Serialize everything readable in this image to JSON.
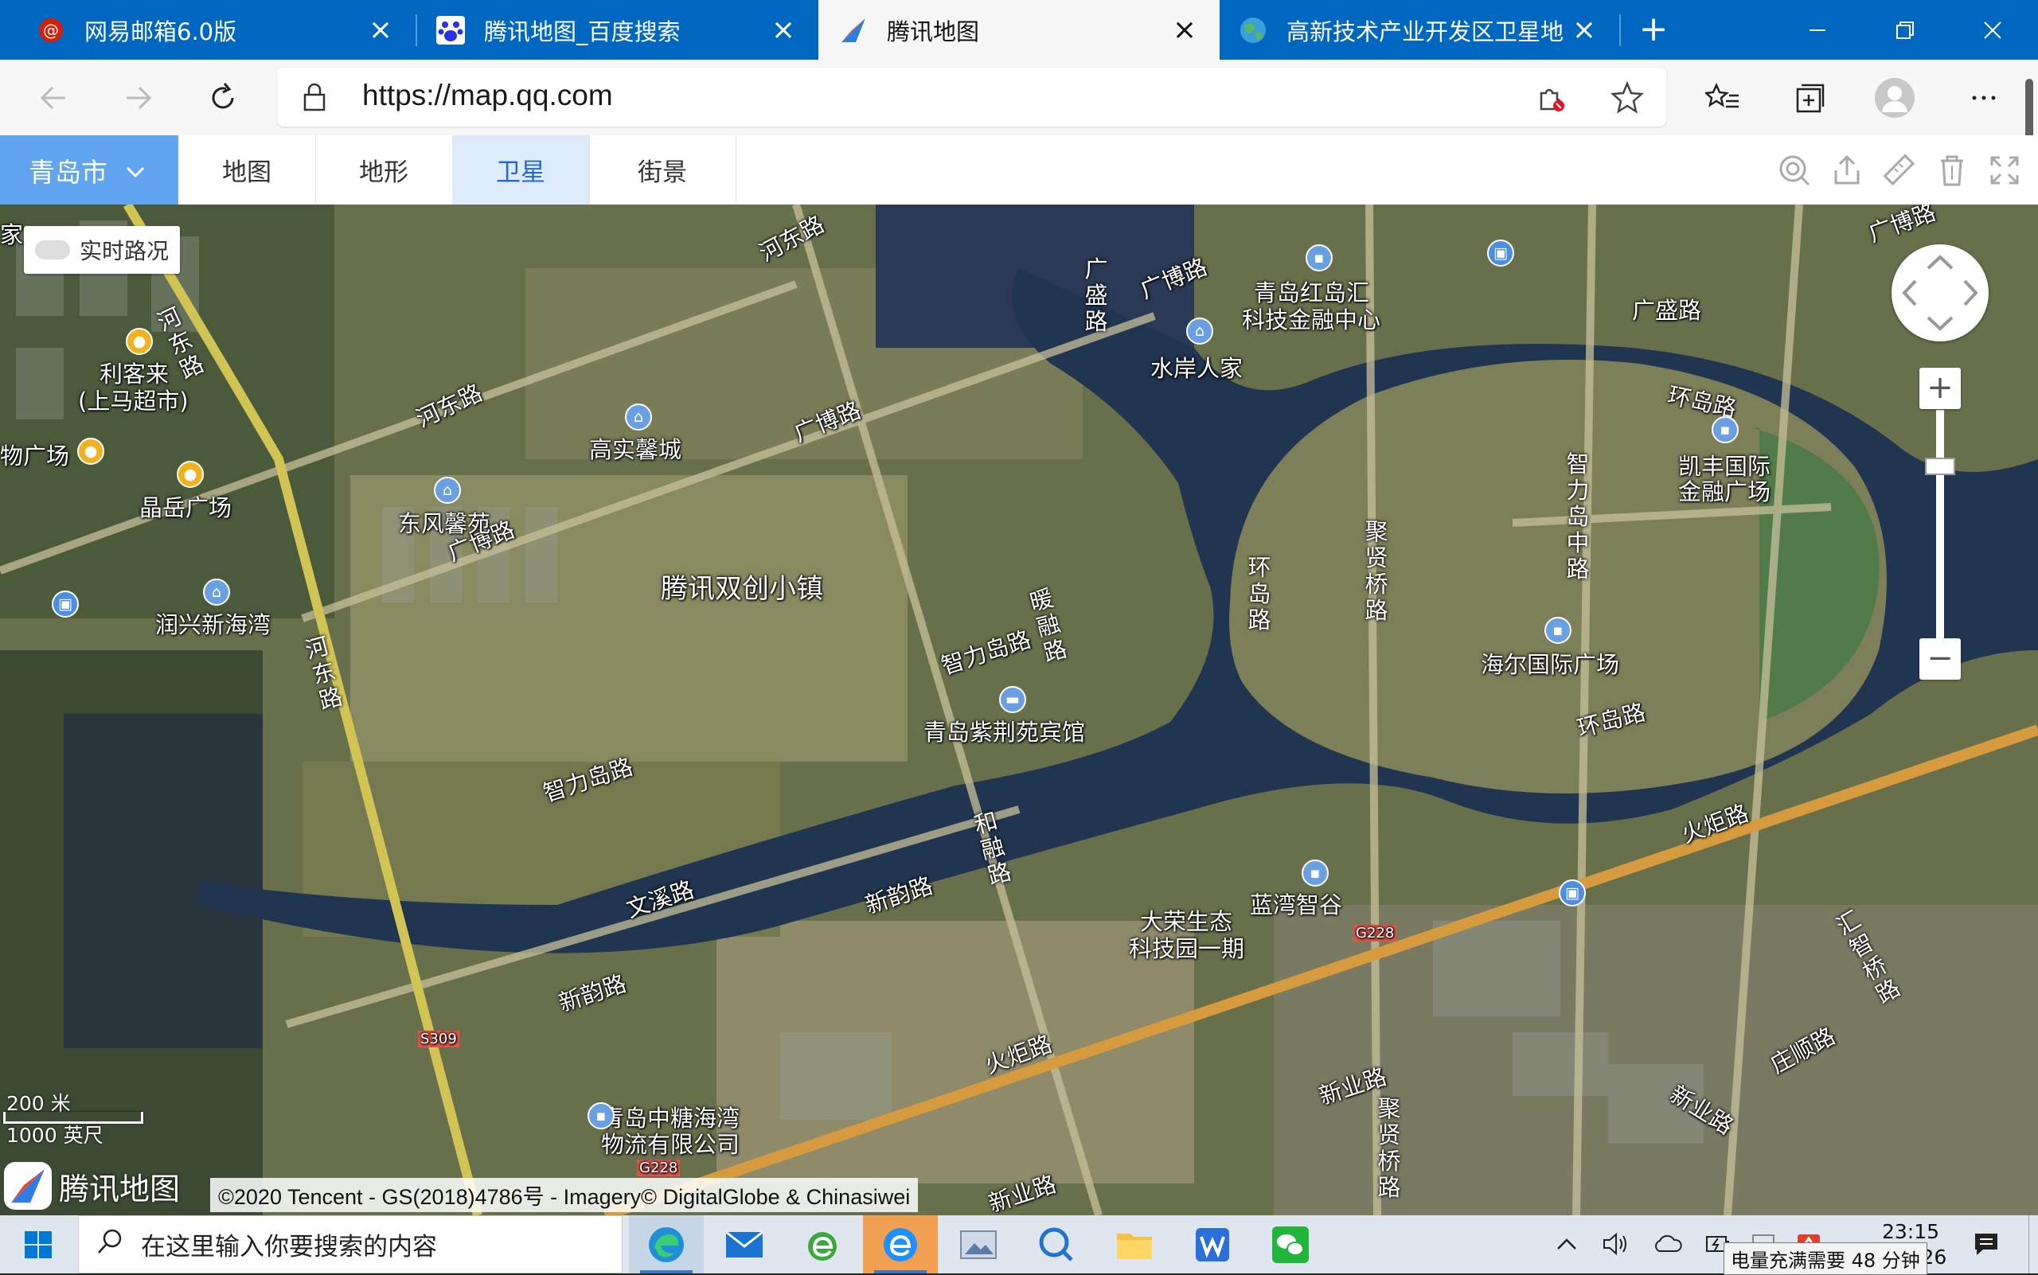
{
  "browser": {
    "tabs": [
      {
        "label": "网易邮箱6.0版",
        "icon": "netease-mail-icon",
        "active": false
      },
      {
        "label": "腾讯地图_百度搜索",
        "icon": "baidu-paw-icon",
        "active": false
      },
      {
        "label": "腾讯地图",
        "icon": "tencent-map-icon",
        "active": true
      },
      {
        "label": "高新技术产业开发区卫星地",
        "icon": "globe-icon",
        "active": false
      }
    ],
    "url": "https://map.qq.com"
  },
  "map_toolbar": {
    "city": "青岛市",
    "tabs": [
      "地图",
      "地形",
      "卫星",
      "街景"
    ],
    "selected_tab": "卫星"
  },
  "map": {
    "traffic_toggle": "实时路况",
    "labels": {
      "hedong_road_1": "河东路",
      "hedong_road_2": "河东路",
      "guangbo_road_top": "广博路",
      "guangbo_road_mid": "广博路",
      "guangbo_road_left": "广博路",
      "guangbo_road_tr": "广博路",
      "guangsheng_road": "广盛路",
      "guangsheng_road_v": "广盛路",
      "hongdao_center_1": "青岛红岛汇",
      "hongdao_center_2": "科技金融中心",
      "shuian_renjia": "水岸人家",
      "lihaolai_1": "利客来",
      "lihaolai_2": "(上马超市)",
      "wu_plaza": "物广场",
      "jingyue_plaza": "晶岳广场",
      "gaoshi_xincheng": "高实馨城",
      "dongfeng_xinyuan": "东风馨苑",
      "runxing_xinhaiwan": "润兴新海湾",
      "tencent_town": "腾讯双创小镇",
      "zhilidao_road_1": "智力岛路",
      "zhilidao_road_2": "智力岛路",
      "zhilidao_mid_road": "智力岛中路",
      "nuanrong_road": "暖融路",
      "zijing_hotel": "青岛紫荆苑宾馆",
      "huandao_road_v": "环岛路",
      "huandao_road_1": "环岛路",
      "huandao_road_2": "环岛路",
      "juxian_bridge_road": "聚贤桥路",
      "kaifeng_1": "凯丰国际",
      "kaifeng_2": "金融广场",
      "haier_plaza": "海尔国际广场",
      "hedong_road_v": "河东路",
      "hedong_road_v2": "河东路",
      "herong_road": "和融路",
      "wenxi_road": "文溪路",
      "xinyun_road_1": "新韵路",
      "xinyun_road_2": "新韵路",
      "lanwan_zhigu": "蓝湾智谷",
      "darong_1": "大荣生态",
      "darong_2": "科技园一期",
      "huoju_road_1": "火炬路",
      "huoju_road_2": "火炬路",
      "huizhi_bridge_road": "汇智桥路",
      "zhuangshun_road": "庄顺路",
      "xinye_road_1": "新业路",
      "xinye_road_2": "新业路",
      "xinye_road_3": "新业路",
      "juxian_bridge_road_2": "聚贤桥路",
      "zhongtang_1": "青岛中糖海湾",
      "zhongtang_2": "物流有限公司",
      "jiake": "家",
      "s309": "S309",
      "g228_1": "G228",
      "g228_2": "G228"
    },
    "scale_metric": "200 米",
    "scale_imperial": "1000 英尺",
    "brand": "腾讯地图",
    "copyright": "©2020 Tencent - GS(2018)4786号 - Imagery© DigitalGlobe & Chinasiwei"
  },
  "taskbar": {
    "search_placeholder": "在这里输入你要搜索的内容",
    "time": "23:15",
    "date_partial": "/26",
    "battery_tooltip": "电量充满需要 48 分钟"
  }
}
